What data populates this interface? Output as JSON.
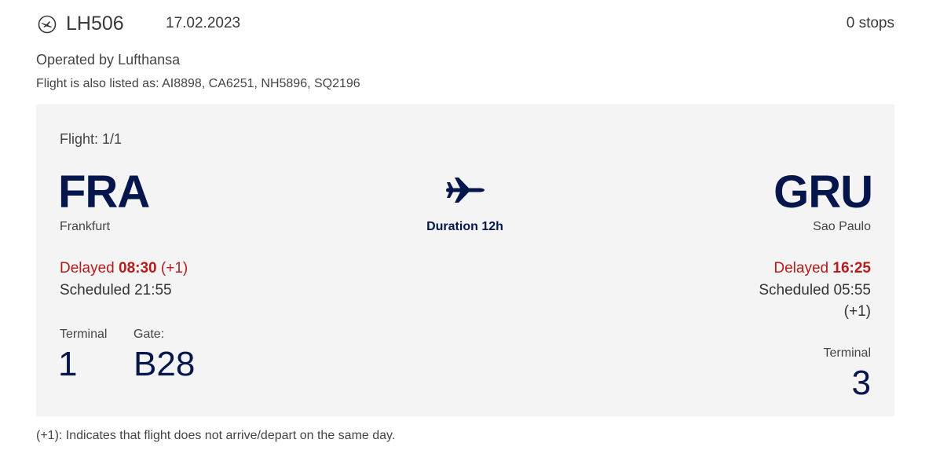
{
  "header": {
    "flight_number": "LH506",
    "date": "17.02.2023",
    "stops": "0 stops"
  },
  "operated_by": "Operated by Lufthansa",
  "also_listed": "Flight is also listed as: AI8898, CA6251, NH5896, SQ2196",
  "card": {
    "flight_count": "Flight: 1/1",
    "duration": "Duration 12h",
    "departure": {
      "code": "FRA",
      "city": "Frankfurt",
      "delayed_label": "Delayed",
      "delayed_time": "08:30",
      "delayed_plus": "(+1)",
      "scheduled": "Scheduled 21:55",
      "terminal_label": "Terminal",
      "terminal": "1",
      "gate_label": "Gate:",
      "gate": "B28"
    },
    "arrival": {
      "code": "GRU",
      "city": "Sao Paulo",
      "delayed_label": "Delayed",
      "delayed_time": "16:25",
      "scheduled": "Scheduled 05:55",
      "scheduled_plus": "(+1)",
      "terminal_label": "Terminal",
      "terminal": "3"
    }
  },
  "footnote": "(+1): Indicates that flight does not arrive/depart on the same day.",
  "icons": {
    "airline": "lufthansa-crane-icon",
    "plane": "airplane-icon"
  },
  "colors": {
    "navy": "#05164d",
    "delayed_red": "#b51b1b",
    "card_bg": "#f4f4f4"
  }
}
